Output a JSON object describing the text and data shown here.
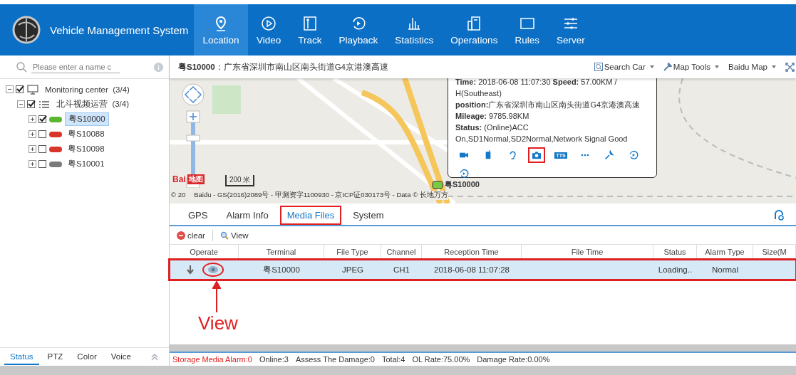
{
  "header": {
    "title": "Vehicle Management System",
    "nav": [
      {
        "label": "Location",
        "selected": true
      },
      {
        "label": "Video",
        "selected": false
      },
      {
        "label": "Track",
        "selected": false
      },
      {
        "label": "Playback",
        "selected": false
      },
      {
        "label": "Statistics",
        "selected": false
      },
      {
        "label": "Operations",
        "selected": false
      },
      {
        "label": "Rules",
        "selected": false
      },
      {
        "label": "Server",
        "selected": false
      }
    ]
  },
  "sidebar": {
    "search": {
      "placeholder": "Please enter a name c"
    },
    "tree": [
      {
        "kind": "center",
        "label": "Monitoring center",
        "count": "(3/4)",
        "checked": true,
        "expanded": true,
        "selected": false,
        "children": [
          {
            "kind": "group",
            "label": "北斗视频运营",
            "count": "(3/4)",
            "checked": true,
            "expanded": true,
            "selected": false,
            "children": [
              {
                "kind": "vehicle",
                "label": "粤S10000",
                "checked": true,
                "expanded": false,
                "selected": true,
                "color": "#5cb531"
              },
              {
                "kind": "vehicle",
                "label": "粤S10088",
                "checked": false,
                "expanded": false,
                "selected": false,
                "color": "#d9362b"
              },
              {
                "kind": "vehicle",
                "label": "粤S10098",
                "checked": false,
                "expanded": false,
                "selected": false,
                "color": "#d9362b"
              },
              {
                "kind": "vehicle",
                "label": "粤S10001",
                "checked": false,
                "expanded": false,
                "selected": false,
                "color": "#7a7a7a"
              }
            ]
          }
        ]
      }
    ],
    "bottom_tabs": [
      {
        "label": "Status",
        "selected": true
      },
      {
        "label": "PTZ",
        "selected": false
      },
      {
        "label": "Color",
        "selected": false
      },
      {
        "label": "Voice",
        "selected": false
      }
    ]
  },
  "address_bar": {
    "plate": "粤S10000",
    "address": "：广东省深圳市南山区南头街道G4京港澳高速"
  },
  "map_toolbar": [
    {
      "label": "Search Car",
      "kind": "search"
    },
    {
      "label": "Map Tools",
      "kind": "tools"
    },
    {
      "label": "Baidu Map",
      "kind": "plain"
    }
  ],
  "map": {
    "logo": "Bai",
    "logo_cn": "地图",
    "scale": "200 米",
    "copyright": "© 20",
    "copyright_rest": "Baidu - GS(2016)2089号 - 甲测资字1100930 - 京ICP证030173号 - Data © 长地万方",
    "marker_label": "粤S10000",
    "popup": {
      "lines": [
        "**Time:** 2018-06-08 11:07:30 **Speed:** 57.00KM / H(Southeast)",
        "**position:**广东省深圳市南山区南头街道G4京港澳高速",
        "**Mileage:** 9785.98KM",
        "**Status:** (Online)ACC On,SD1Normal,SD2Normal,Network Signal Good"
      ],
      "actions": [
        {
          "highlighted": false
        },
        {
          "highlighted": false
        },
        {
          "highlighted": false
        },
        {
          "highlighted": true
        },
        {
          "label": "TTS",
          "highlighted": false
        },
        {
          "highlighted": false
        },
        {
          "highlighted": false
        },
        {
          "highlighted": false
        },
        {
          "highlighted": false
        }
      ]
    }
  },
  "detail_tabs": [
    {
      "label": "GPS",
      "selected": false,
      "highlighted": false
    },
    {
      "label": "Alarm Info",
      "selected": false,
      "highlighted": false
    },
    {
      "label": "Media Files",
      "selected": true,
      "highlighted": true
    },
    {
      "label": "System",
      "selected": false,
      "highlighted": false
    }
  ],
  "toolbar": [
    {
      "label": "clear",
      "kind": "clear"
    },
    {
      "label": "View",
      "kind": "view"
    }
  ],
  "table": {
    "columns": [
      "Operate",
      "Terminal",
      "File Type",
      "Channel",
      "Reception Time",
      "File Time",
      "Status",
      "Alarm Type",
      "Size(M"
    ],
    "rows": [
      {
        "selected": true,
        "highlighted": true,
        "view_highlighted": true,
        "cells": [
          "",
          "粤S10000",
          "JPEG",
          "CH1",
          "2018-06-08 11:07:28",
          "",
          "Loading..",
          "Normal",
          ""
        ]
      }
    ]
  },
  "annotation": {
    "label": "View"
  },
  "status_bar": [
    {
      "text": "Storage Media Alarm:0",
      "alert": true
    },
    {
      "text": "Online:3",
      "alert": false
    },
    {
      "text": "Assess The Damage:0",
      "alert": false
    },
    {
      "text": "Total:4",
      "alert": false
    },
    {
      "text": "OL Rate:75.00%",
      "alert": false
    },
    {
      "text": "Damage Rate:0.00%",
      "alert": false
    }
  ]
}
